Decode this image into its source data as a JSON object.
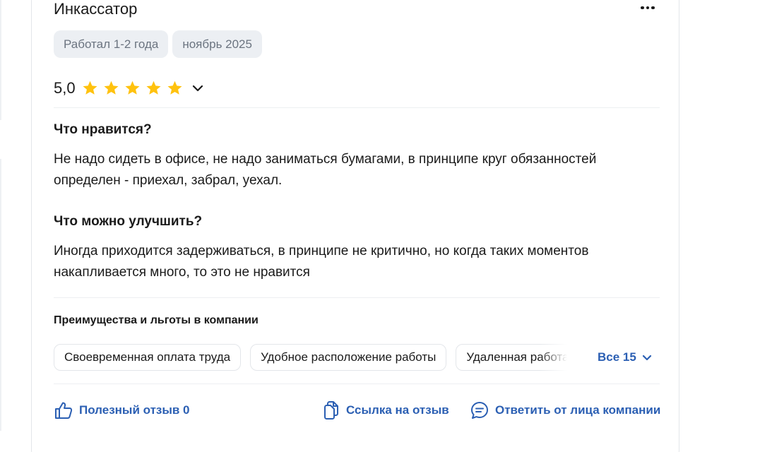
{
  "review": {
    "title": "Инкассатор",
    "tags": [
      "Работал 1-2 года",
      "ноябрь 2025"
    ],
    "rating": {
      "value_label": "5,0",
      "value": 5,
      "max": 5,
      "star_color": "#ffc20e"
    },
    "likes": {
      "heading": "Что нравится?",
      "lines": [
        "Не надо сидеть в офисе, не надо заниматься бумагами, в принципе круг обязанностей",
        "определен - приехал, забрал, уехал."
      ]
    },
    "improve": {
      "heading": "Что можно улучшить?",
      "lines": [
        "Иногда приходится задерживаться, в принципе не критично, но когда таких моментов",
        "накапливается много, то это не нравится"
      ]
    },
    "benefits": {
      "heading": "Преимущества и льготы в компании",
      "chips": [
        "Своевременная оплата труда",
        "Удобное расположение работы",
        "Удаленная работа"
      ],
      "all_label": "Все 15"
    },
    "actions": {
      "helpful_label": "Полезный отзыв 0",
      "link_label": "Ссылка на отзыв",
      "reply_label": "Ответить от лица компании"
    }
  },
  "icons": {
    "more": "more-horizontal-icon",
    "rating_expand": "chevron-down-icon",
    "all_expand": "chevron-down-icon",
    "helpful": "thumbs-up-icon",
    "link": "copy-icon",
    "reply": "chat-bubble-icon"
  },
  "colors": {
    "accent": "#2b5fb3",
    "star": "#ffc20e",
    "tag_bg": "#eceff3",
    "tag_text": "#6b7480"
  }
}
